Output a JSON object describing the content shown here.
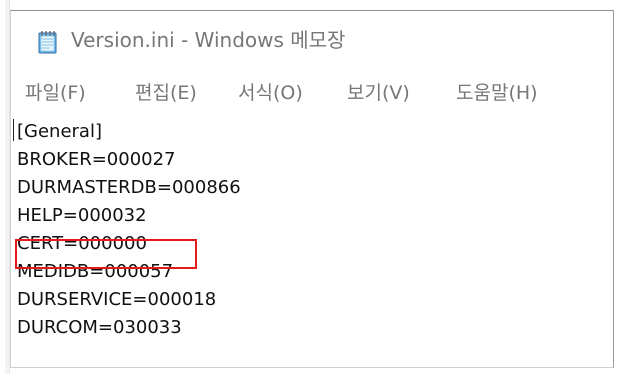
{
  "window": {
    "title": "Version.ini - Windows 메모장",
    "icon": "notepad-icon"
  },
  "menu": {
    "file": "파일(F)",
    "edit": "편집(E)",
    "format": "서식(O)",
    "view": "보기(V)",
    "help": "도움말(H)"
  },
  "editor": {
    "lines": [
      "[General]",
      "BROKER=000027",
      "DURMASTERDB=000866",
      "HELP=000032",
      "CERT=000000",
      "MEDIDB=000057",
      "DURSERVICE=000018",
      "DURCOM=030033"
    ],
    "highlighted_line": "CERT=000000",
    "highlight_color": "#e21b1b"
  }
}
